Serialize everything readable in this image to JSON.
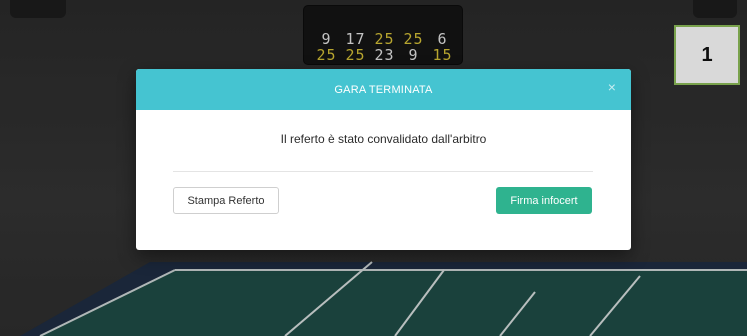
{
  "scoreboard": {
    "row1": [
      "9",
      "17",
      "25",
      "25",
      "6"
    ],
    "row2": [
      "25",
      "25",
      "23",
      "9",
      "15"
    ]
  },
  "badge": {
    "label": "1"
  },
  "modal": {
    "title": "GARA TERMINATA",
    "close_symbol": "×",
    "message": "Il referto è stato convalidato dall'arbitro",
    "buttons": {
      "print_label": "Stampa Referto",
      "sign_label": "Firma infocert"
    }
  },
  "colors": {
    "header": "#45c4d1",
    "primary_button": "#2fb38f",
    "badge_border": "#8fbf5a",
    "court": "#1f4d47"
  },
  "icons": {
    "close": "close-icon"
  }
}
